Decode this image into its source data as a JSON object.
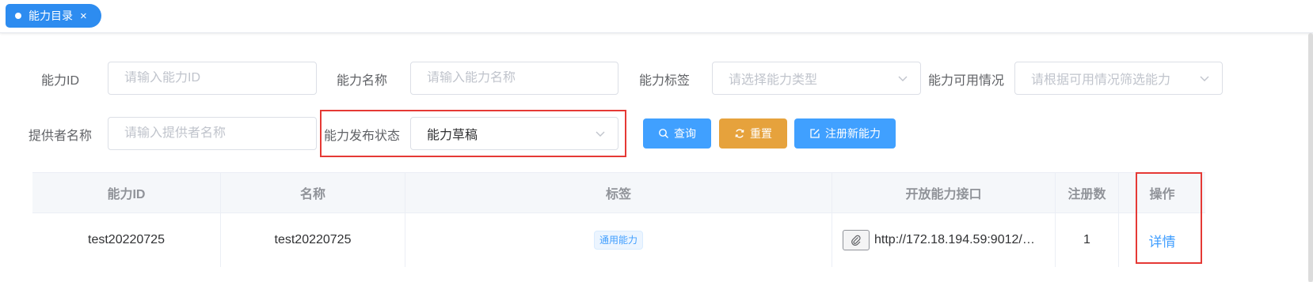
{
  "tab": {
    "label": "能力目录",
    "close": "×"
  },
  "form": {
    "ability_id": {
      "label": "能力ID",
      "placeholder": "请输入能力ID"
    },
    "ability_name": {
      "label": "能力名称",
      "placeholder": "请输入能力名称"
    },
    "ability_tag": {
      "label": "能力标签",
      "placeholder": "请选择能力类型"
    },
    "availability": {
      "label": "能力可用情况",
      "placeholder": "请根据可用情况筛选能力"
    },
    "provider": {
      "label": "提供者名称",
      "placeholder": "请输入提供者名称"
    },
    "publish_status": {
      "label": "能力发布状态",
      "value": "能力草稿"
    }
  },
  "buttons": {
    "search": "查询",
    "reset": "重置",
    "register": "注册新能力"
  },
  "table": {
    "headers": [
      "能力ID",
      "名称",
      "标签",
      "开放能力接口",
      "注册数",
      "操作"
    ],
    "rows": [
      {
        "id": "test20220725",
        "name": "test20220725",
        "tag": "通用能力",
        "api": "http://172.18.194.59:9012/…",
        "count": "1",
        "action": "详情"
      }
    ]
  },
  "colors": {
    "primary": "#409eff",
    "tab": "#2d8cf0",
    "warning": "#e6a23c",
    "highlight": "#e53935"
  }
}
